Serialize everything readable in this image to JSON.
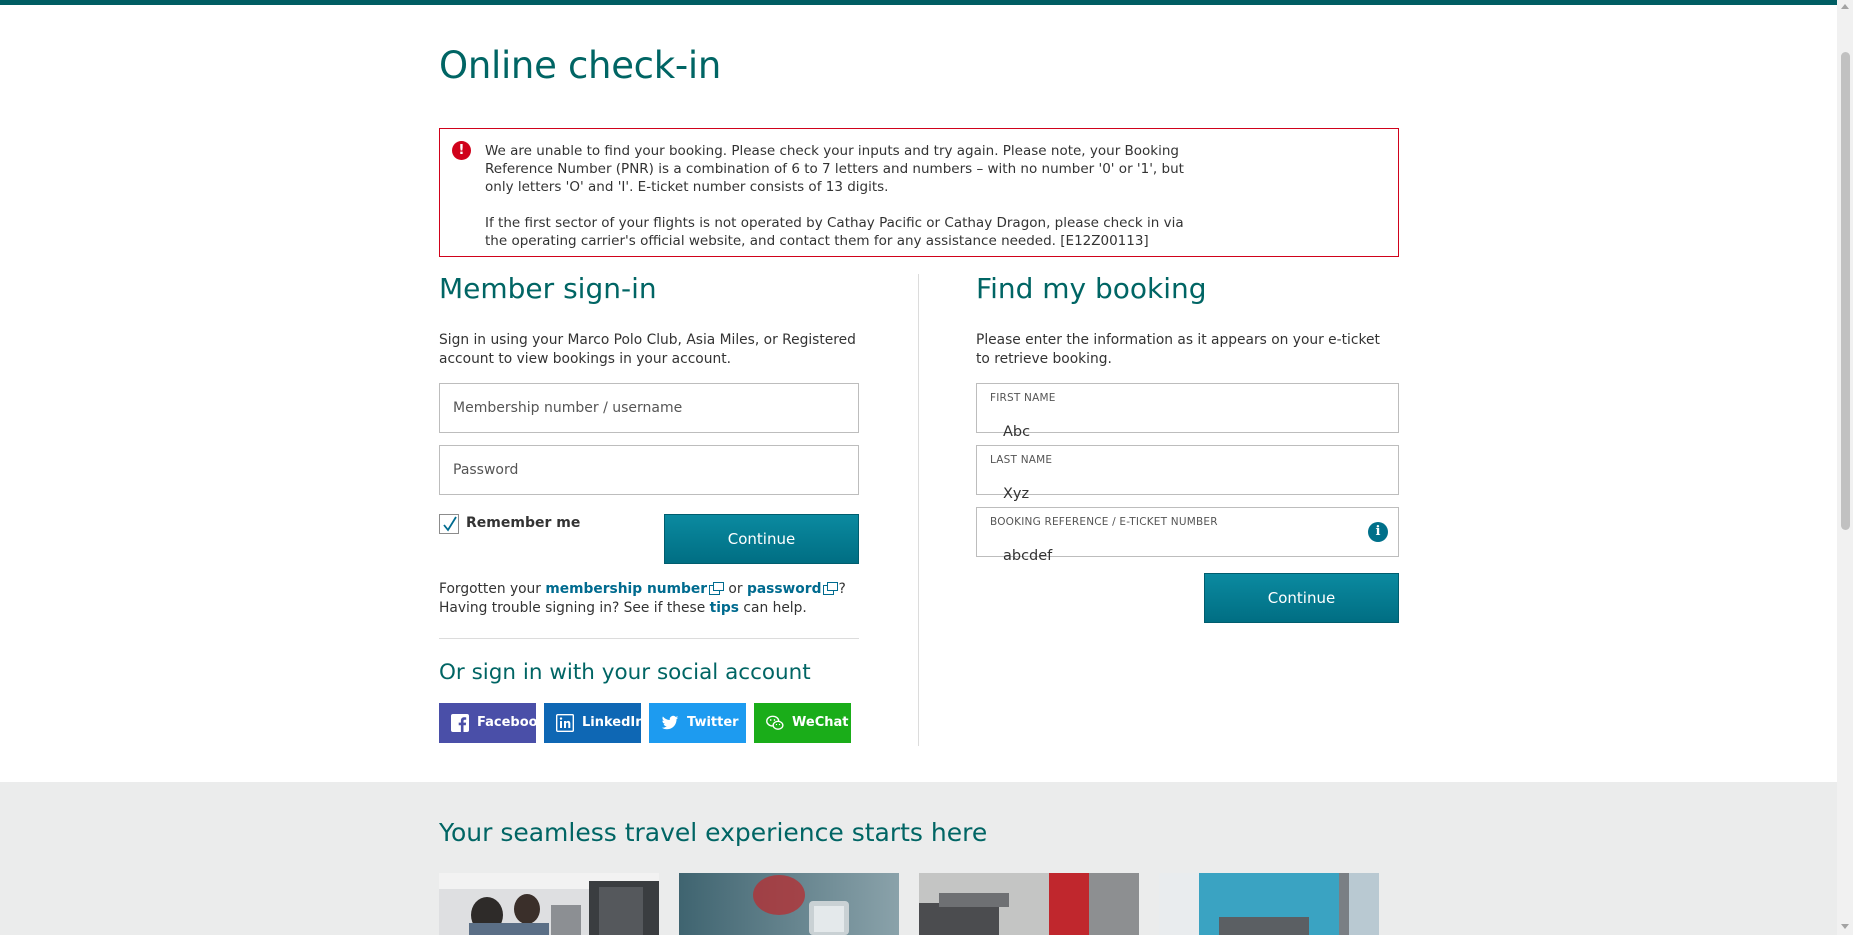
{
  "page": {
    "title": "Online check-in"
  },
  "error": {
    "icon": "exclamation-icon",
    "paragraph1": "We are unable to find your booking. Please check your inputs and try again. Please note, your Booking Reference Number (PNR) is a combination of 6 to 7 letters and numbers – with no number '0' or '1', but only letters 'O' and 'I'. E-ticket number consists of 13 digits.",
    "paragraph2": "If the first sector of your flights is not operated by Cathay Pacific or Cathay Dragon, please check in via the operating carrier's official website, and contact them for any assistance needed. [E12Z00113]"
  },
  "member": {
    "title": "Member sign-in",
    "intro": "Sign in using your Marco Polo Club, Asia Miles, or Registered account to view bookings in your account.",
    "username_placeholder": "Membership number / username",
    "password_placeholder": "Password",
    "remember_label": "Remember me",
    "remember_checked": true,
    "continue_label": "Continue",
    "forgot_prefix": "Forgotten your",
    "forgot_membership_link": "membership number",
    "forgot_or": "or",
    "forgot_password_link": "password",
    "forgot_suffix": "?",
    "trouble_prefix": "Having trouble signing in? See if these",
    "tips_link": "tips",
    "trouble_suffix": "can help."
  },
  "social": {
    "title": "Or sign in with your social account",
    "buttons": [
      {
        "label": "Facebook",
        "color": "#3b5998",
        "icon": "facebook-icon"
      },
      {
        "label": "LinkedIn",
        "color": "#0e67b4",
        "icon": "linkedin-icon"
      },
      {
        "label": "Twitter",
        "color": "#1da1f2",
        "icon": "twitter-icon"
      },
      {
        "label": "WeChat",
        "color": "#1aad19",
        "icon": "wechat-icon"
      }
    ]
  },
  "booking": {
    "title": "Find my booking",
    "intro": "Please enter the information as it appears on your e-ticket to retrieve booking.",
    "first_name_label": "FIRST NAME",
    "first_name_value": "Abc",
    "last_name_label": "LAST NAME",
    "last_name_value": "Xyz",
    "reference_label": "BOOKING REFERENCE / E-TICKET NUMBER",
    "reference_value": "abcdef",
    "continue_label": "Continue"
  },
  "promo": {
    "title": "Your seamless travel experience starts here"
  },
  "colors": {
    "brand": "#006564",
    "button": "#0b8aa0",
    "error": "#d0021b"
  }
}
